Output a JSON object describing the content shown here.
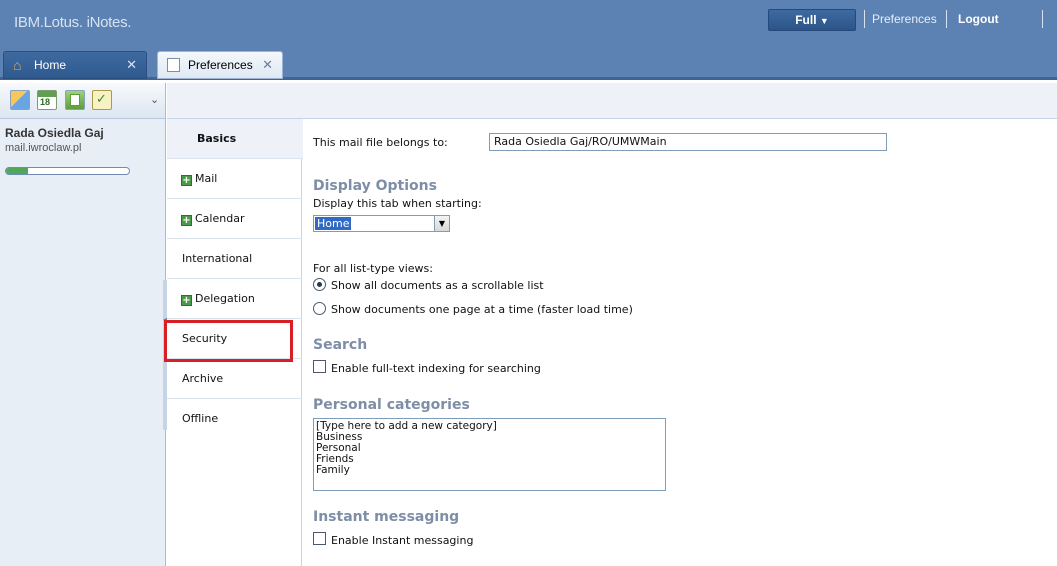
{
  "header": {
    "brand": "IBM.Lotus. iNotes.",
    "mode_label": "Full",
    "preferences_link": "Preferences",
    "logout_link": "Logout"
  },
  "tabs": [
    {
      "label": "Home",
      "icon": "home-icon",
      "active": false
    },
    {
      "label": "Preferences",
      "icon": "document-icon",
      "active": true
    }
  ],
  "sidebar": {
    "calendar_icon_text": "18",
    "user_name": "Rada Osiedla Gaj",
    "user_domain": "mail.iwroclaw.pl",
    "quota_fill_fraction": 0.18
  },
  "pref_nav": {
    "items": [
      {
        "label": "Basics",
        "expandable": false,
        "selected": true
      },
      {
        "label": "Mail",
        "expandable": true,
        "selected": false
      },
      {
        "label": "Calendar",
        "expandable": true,
        "selected": false
      },
      {
        "label": "International",
        "expandable": false,
        "selected": false
      },
      {
        "label": "Delegation",
        "expandable": true,
        "selected": false
      },
      {
        "label": "Security",
        "expandable": false,
        "selected": false
      },
      {
        "label": "Archive",
        "expandable": false,
        "selected": false
      },
      {
        "label": "Offline",
        "expandable": false,
        "selected": false
      }
    ],
    "highlighted_item": "Security",
    "highlight_color": "#d81f26"
  },
  "content": {
    "belongs_label": "This mail file belongs to:",
    "belongs_value": "Rada Osiedla Gaj/RO/UMWMain",
    "display_options": {
      "heading": "Display Options",
      "startup_label": "Display this tab when starting:",
      "startup_value": "Home",
      "list_views_label": "For all list-type views:",
      "radio_scrollable": "Show all documents as a scrollable list",
      "radio_paged": "Show documents one page at a time (faster load time)",
      "selected_radio": "scrollable"
    },
    "search": {
      "heading": "Search",
      "fulltext_label": "Enable full-text indexing for searching",
      "fulltext_checked": false
    },
    "personal_categories": {
      "heading": "Personal categories",
      "items": [
        "[Type here to add a new category]",
        "Business",
        "Personal",
        "Friends",
        "Family"
      ]
    },
    "instant_messaging": {
      "heading": "Instant messaging",
      "enable_label": "Enable Instant messaging",
      "enable_checked": false
    }
  },
  "colors": {
    "topbar": "#5b82b3",
    "section_heading": "#7d8ea6"
  }
}
